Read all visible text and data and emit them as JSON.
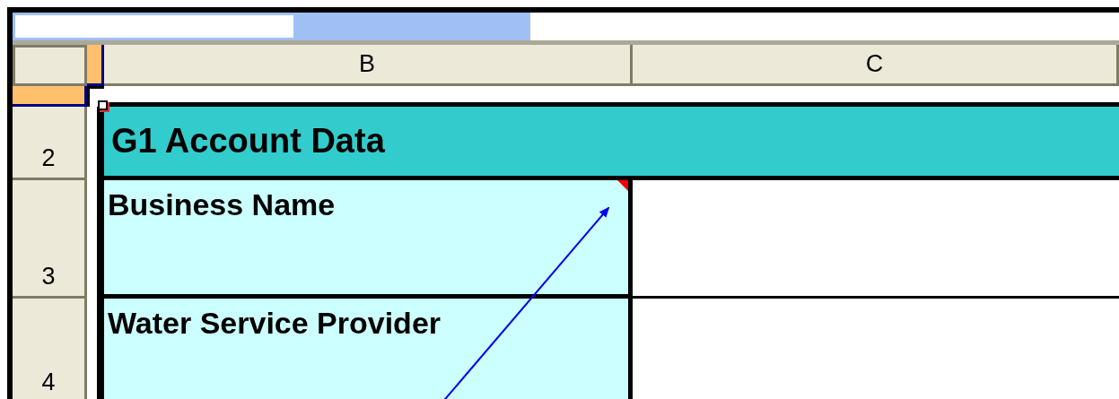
{
  "columns": [
    {
      "selected": true
    },
    {
      "label": "B",
      "selected": false
    },
    {
      "label": "C",
      "selected": false
    }
  ],
  "rows": [
    {
      "selected": true
    },
    {
      "label": "2",
      "selected": false
    },
    {
      "label": "3",
      "selected": false
    },
    {
      "label": "4",
      "selected": false
    }
  ],
  "sheet": {
    "title": "G1 Account Data",
    "fields": [
      {
        "label": "Business Name",
        "comment": true
      },
      {
        "label": "Water Service Provider",
        "comment": false
      }
    ]
  },
  "annotation": {
    "kind": "arrow"
  }
}
